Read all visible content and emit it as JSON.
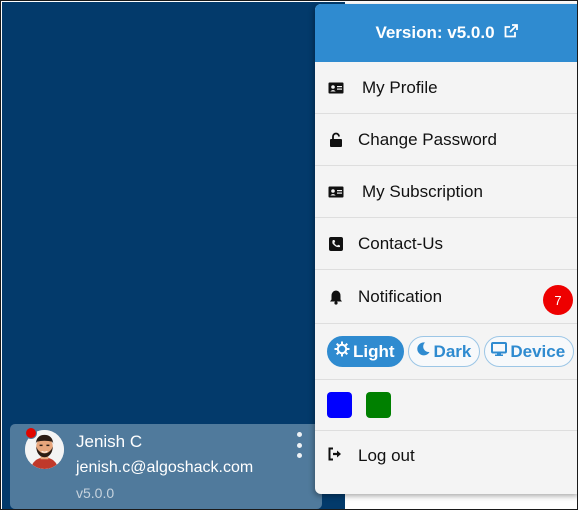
{
  "menu": {
    "version_label": "Version: v5.0.0",
    "items": [
      {
        "label": "My Profile",
        "icon": "id-card-icon"
      },
      {
        "label": "Change Password",
        "icon": "unlock-icon"
      },
      {
        "label": "My Subscription",
        "icon": "id-card-icon"
      },
      {
        "label": "Contact-Us",
        "icon": "phone-icon"
      },
      {
        "label": "Notification",
        "icon": "bell-icon",
        "badge": "7"
      }
    ],
    "themes": [
      {
        "label": "Light",
        "icon": "sun-gear-icon",
        "active": true
      },
      {
        "label": "Dark",
        "icon": "moon-icon",
        "active": false
      },
      {
        "label": "Device",
        "icon": "monitor-icon",
        "active": false
      }
    ],
    "colors": [
      "#0000ff",
      "#008000"
    ],
    "logout_label": "Log out"
  },
  "user": {
    "name": "Jenish C",
    "email": "jenish.c@algoshack.com",
    "version": "v5.0.0"
  },
  "theme_colors": {
    "accent": "#2f8bd0",
    "sidebar": "#033a6b",
    "badge": "#ee0000"
  }
}
